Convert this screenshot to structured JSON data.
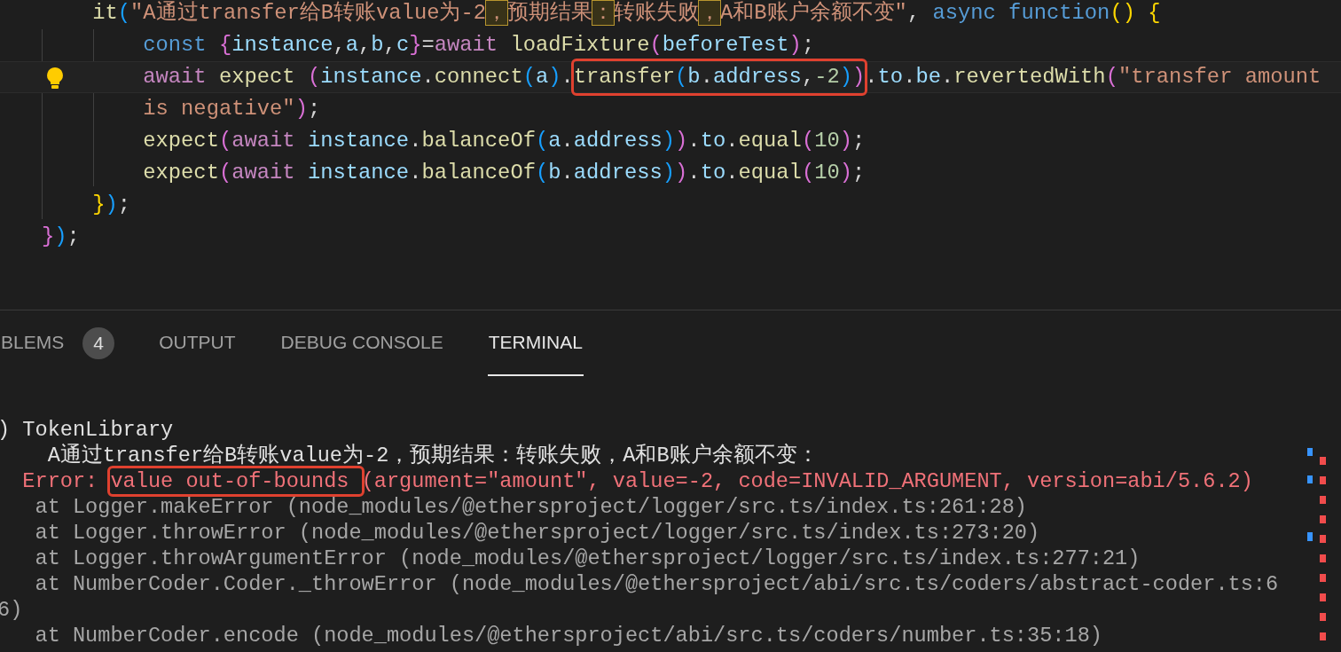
{
  "editor": {
    "lines": [
      {
        "current": false,
        "segments": [
          {
            "kind": "fn",
            "text": "    it"
          },
          {
            "kind": "b3",
            "text": "("
          },
          {
            "kind": "str",
            "text": "\"A通过transfer给B转账value为-2"
          },
          {
            "kind": "uni",
            "text": "，"
          },
          {
            "kind": "str",
            "text": "预期结果"
          },
          {
            "kind": "uni",
            "text": "："
          },
          {
            "kind": "str",
            "text": "转账失败"
          },
          {
            "kind": "uni",
            "text": "，"
          },
          {
            "kind": "str",
            "text": "A和B账户余额不变\""
          },
          {
            "kind": "punct",
            "text": ", "
          },
          {
            "kind": "storage",
            "text": "async function"
          },
          {
            "kind": "b1",
            "text": "()"
          },
          {
            "kind": "b1",
            "text": " {"
          }
        ]
      },
      {
        "current": false,
        "segments": [
          {
            "kind": "storage",
            "text": "        const "
          },
          {
            "kind": "b2",
            "text": "{"
          },
          {
            "kind": "var",
            "text": "instance"
          },
          {
            "kind": "punct",
            "text": ","
          },
          {
            "kind": "var",
            "text": "a"
          },
          {
            "kind": "punct",
            "text": ","
          },
          {
            "kind": "var",
            "text": "b"
          },
          {
            "kind": "punct",
            "text": ","
          },
          {
            "kind": "var",
            "text": "c"
          },
          {
            "kind": "b2",
            "text": "}"
          },
          {
            "kind": "punct",
            "text": "="
          },
          {
            "kind": "kw",
            "text": "await "
          },
          {
            "kind": "fn",
            "text": "loadFixture"
          },
          {
            "kind": "b2",
            "text": "("
          },
          {
            "kind": "var",
            "text": "beforeTest"
          },
          {
            "kind": "b2",
            "text": ")"
          },
          {
            "kind": "punct",
            "text": ";"
          }
        ]
      },
      {
        "current": true,
        "lightbulb": true,
        "segments": [
          {
            "kind": "kw",
            "text": "        await "
          },
          {
            "kind": "fn",
            "text": "expect "
          },
          {
            "kind": "b2",
            "text": "("
          },
          {
            "kind": "var",
            "text": "instance"
          },
          {
            "kind": "punct",
            "text": "."
          },
          {
            "kind": "fn",
            "text": "connect"
          },
          {
            "kind": "b3",
            "text": "("
          },
          {
            "kind": "var",
            "text": "a"
          },
          {
            "kind": "b3",
            "text": ")"
          },
          {
            "kind": "punct",
            "text": "."
          },
          {
            "kind": "callout",
            "tokens": [
              {
                "kind": "fn",
                "text": "transfer"
              },
              {
                "kind": "b3",
                "text": "("
              },
              {
                "kind": "var",
                "text": "b"
              },
              {
                "kind": "punct",
                "text": "."
              },
              {
                "kind": "var",
                "text": "address"
              },
              {
                "kind": "punct",
                "text": ","
              },
              {
                "kind": "num",
                "text": "-2"
              },
              {
                "kind": "b3",
                "text": ")"
              },
              {
                "kind": "b2",
                "text": ")"
              }
            ]
          },
          {
            "kind": "punct",
            "text": "."
          },
          {
            "kind": "var",
            "text": "to"
          },
          {
            "kind": "punct",
            "text": "."
          },
          {
            "kind": "var",
            "text": "be"
          },
          {
            "kind": "punct",
            "text": "."
          },
          {
            "kind": "fn",
            "text": "revertedWith"
          },
          {
            "kind": "b2",
            "text": "("
          },
          {
            "kind": "str",
            "text": "\"transfer amount"
          }
        ]
      },
      {
        "current": false,
        "segments": [
          {
            "kind": "str",
            "text": "        is negative\""
          },
          {
            "kind": "b2",
            "text": ")"
          },
          {
            "kind": "punct",
            "text": ";"
          }
        ]
      },
      {
        "current": false,
        "segments": [
          {
            "kind": "fn",
            "text": "        expect"
          },
          {
            "kind": "b2",
            "text": "("
          },
          {
            "kind": "kw",
            "text": "await "
          },
          {
            "kind": "var",
            "text": "instance"
          },
          {
            "kind": "punct",
            "text": "."
          },
          {
            "kind": "fn",
            "text": "balanceOf"
          },
          {
            "kind": "b3",
            "text": "("
          },
          {
            "kind": "var",
            "text": "a"
          },
          {
            "kind": "punct",
            "text": "."
          },
          {
            "kind": "var",
            "text": "address"
          },
          {
            "kind": "b3",
            "text": ")"
          },
          {
            "kind": "b2",
            "text": ")"
          },
          {
            "kind": "punct",
            "text": "."
          },
          {
            "kind": "var",
            "text": "to"
          },
          {
            "kind": "punct",
            "text": "."
          },
          {
            "kind": "fn",
            "text": "equal"
          },
          {
            "kind": "b2",
            "text": "("
          },
          {
            "kind": "num",
            "text": "10"
          },
          {
            "kind": "b2",
            "text": ")"
          },
          {
            "kind": "punct",
            "text": ";"
          }
        ]
      },
      {
        "current": false,
        "segments": [
          {
            "kind": "fn",
            "text": "        expect"
          },
          {
            "kind": "b2",
            "text": "("
          },
          {
            "kind": "kw",
            "text": "await "
          },
          {
            "kind": "var",
            "text": "instance"
          },
          {
            "kind": "punct",
            "text": "."
          },
          {
            "kind": "fn",
            "text": "balanceOf"
          },
          {
            "kind": "b3",
            "text": "("
          },
          {
            "kind": "var",
            "text": "b"
          },
          {
            "kind": "punct",
            "text": "."
          },
          {
            "kind": "var",
            "text": "address"
          },
          {
            "kind": "b3",
            "text": ")"
          },
          {
            "kind": "b2",
            "text": ")"
          },
          {
            "kind": "punct",
            "text": "."
          },
          {
            "kind": "var",
            "text": "to"
          },
          {
            "kind": "punct",
            "text": "."
          },
          {
            "kind": "fn",
            "text": "equal"
          },
          {
            "kind": "b2",
            "text": "("
          },
          {
            "kind": "num",
            "text": "10"
          },
          {
            "kind": "b2",
            "text": ")"
          },
          {
            "kind": "punct",
            "text": ";"
          }
        ]
      },
      {
        "current": false,
        "segments": [
          {
            "kind": "b1",
            "text": "    }"
          },
          {
            "kind": "b3",
            "text": ")"
          },
          {
            "kind": "punct",
            "text": ";"
          }
        ]
      },
      {
        "current": false,
        "segments": [
          {
            "kind": "b2",
            "text": "}"
          },
          {
            "kind": "b3",
            "text": ")"
          },
          {
            "kind": "punct",
            "text": ";"
          }
        ]
      }
    ]
  },
  "panel": {
    "tabs": [
      {
        "label": "BLEMS",
        "badge": "4",
        "selected": false
      },
      {
        "label": "OUTPUT",
        "selected": false
      },
      {
        "label": "DEBUG CONSOLE",
        "selected": false
      },
      {
        "label": "TERMINAL",
        "selected": true
      }
    ],
    "terminal_lines": [
      {
        "segments": [
          {
            "kind": "plain",
            "text": ") TokenLibrary"
          }
        ]
      },
      {
        "segments": [
          {
            "kind": "plain",
            "text": "    A通过transfer给B转账value为-2，预期结果：转账失败，A和B账户余额不变："
          }
        ]
      },
      {
        "segments": [
          {
            "kind": "err",
            "text": "  Error: "
          },
          {
            "kind": "callout",
            "tokens": [
              {
                "kind": "err",
                "text": "value out-of-bounds "
              }
            ]
          },
          {
            "kind": "err",
            "text": "(argument=\"amount\", value=-2, code=INVALID_ARGUMENT, version=abi/5.6.2)"
          }
        ]
      },
      {
        "segments": [
          {
            "kind": "trace",
            "text": "   at Logger.makeError (node_modules/@ethersproject/logger/src.ts/index.ts:261:28)"
          }
        ]
      },
      {
        "segments": [
          {
            "kind": "trace",
            "text": "   at Logger.throwError (node_modules/@ethersproject/logger/src.ts/index.ts:273:20)"
          }
        ]
      },
      {
        "segments": [
          {
            "kind": "trace",
            "text": "   at Logger.throwArgumentError (node_modules/@ethersproject/logger/src.ts/index.ts:277:21)"
          }
        ]
      },
      {
        "segments": [
          {
            "kind": "trace",
            "text": "   at NumberCoder.Coder._throwError (node_modules/@ethersproject/abi/src.ts/coders/abstract-coder.ts:6"
          }
        ]
      },
      {
        "segments": [
          {
            "kind": "trace",
            "text": "6)"
          }
        ]
      },
      {
        "segments": [
          {
            "kind": "trace",
            "text": "   at NumberCoder.encode (node_modules/@ethersproject/abi/src.ts/coders/number.ts:35:18)"
          }
        ]
      }
    ]
  }
}
